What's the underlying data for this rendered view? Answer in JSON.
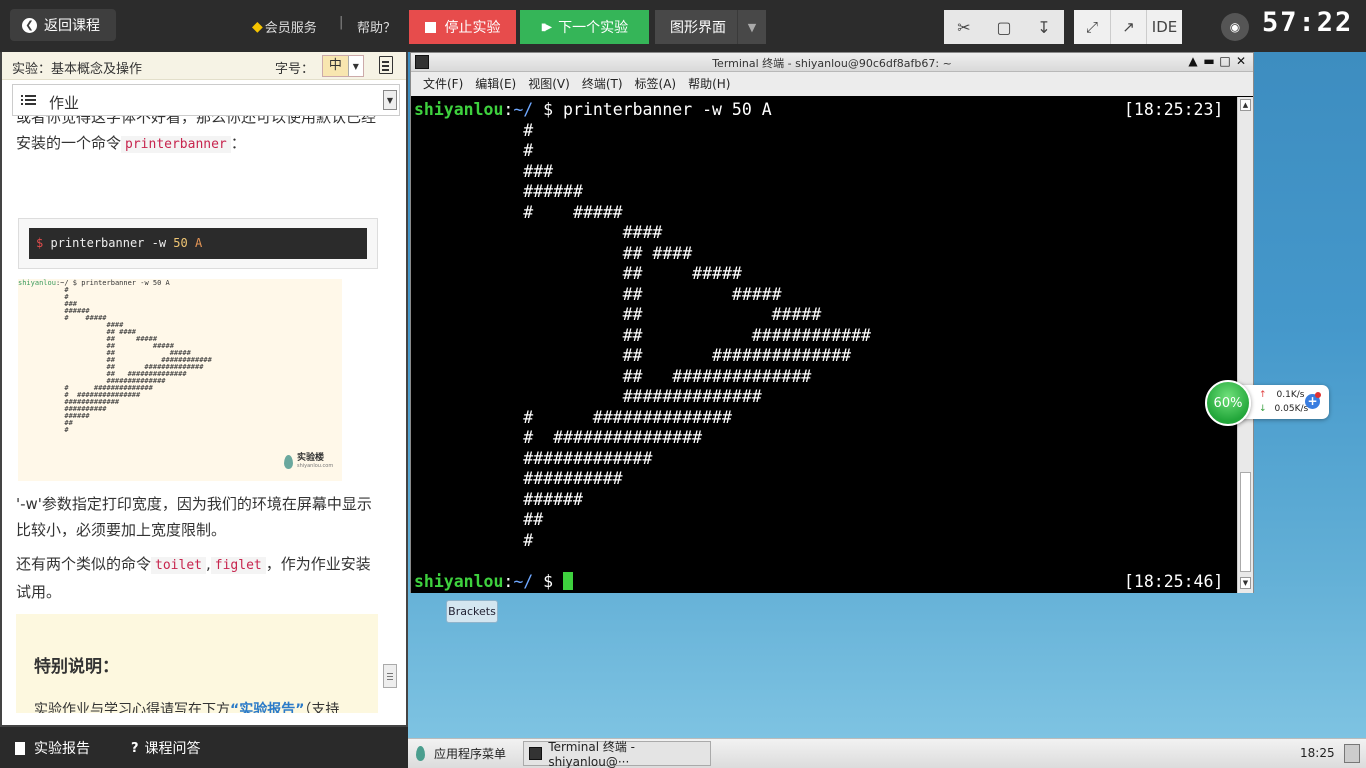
{
  "topbar": {
    "back_label": "返回课程",
    "vip_label": "会员服务",
    "separator": "|",
    "help_label": "帮助？",
    "stop_label": "停止实验",
    "next_label": "下一个实验",
    "gui_label": "图形界面",
    "ide_label": "IDE",
    "timer": "57:22"
  },
  "left_panel": {
    "title": "实验：基本概念及操作",
    "font_size_label": "字号：",
    "font_size_value": "中",
    "section_select": "作业",
    "para1_a": "或者你觉得这字体不好看，那么你还可以使用默认已经安装的一个命令",
    "para1_code": "printerbanner",
    "para1_b": "：",
    "code_prompt": "$",
    "code_cmd": "printerbanner -w",
    "code_num": "50",
    "code_arg": "A",
    "thumb_user": "shiyanlou",
    "thumb_cmd": ":~/ $ printerbanner -w 50 A",
    "thumb_logo": "实验楼",
    "thumb_logo_sub": "shiyanlou.com",
    "para2": "'-w'参数指定打印宽度，因为我们的环境在屏幕中显示比较小，必须要加上宽度限制。",
    "para3_a": "还有两个类似的命令",
    "para3_code1": "toilet",
    "para3_sep": ",",
    "para3_code2": "figlet",
    "para3_b": "，作为作业安装试用。",
    "note_title": "特别说明：",
    "note_a": "实验作业与学习心得请写在下方",
    "note_link": "“实验报告”",
    "note_b": "（支持markdown格式）里并公开，每周选取优秀报告奖励IT书籍！"
  },
  "footer": {
    "report_label": "实验报告",
    "qa_label": "课程问答"
  },
  "terminal": {
    "title": "Terminal 终端 - shiyanlou@90c6df8afb67: ~",
    "menu": [
      "文件(F)",
      "编辑(E)",
      "视图(V)",
      "终端(T)",
      "标签(A)",
      "帮助(H)"
    ],
    "user": "shiyanlou",
    "colon": ":",
    "path": "~/",
    "prompt_tail": " $ ",
    "command": "printerbanner -w 50 A",
    "time1": "[18:25:23]",
    "time2": "[18:25:46]",
    "output": "           #\n           #\n           ###\n           ######\n           #    #####\n                     ####\n                     ## ####\n                     ##     #####\n                     ##         #####\n                     ##             #####\n                     ##           ############\n                     ##       ##############\n                     ##   ##############\n                     ##############\n           #      ##############\n           #  ###############\n           #############\n           ##########\n           ######\n           ##\n           #"
  },
  "desktop": {
    "brackets_label": "Brackets",
    "net_percent": "60%",
    "net_up": "0.1K/s",
    "net_down": "0.05K/s"
  },
  "taskbar": {
    "apps_menu": "应用程序菜单",
    "task_label": "Terminal 终端 - shiyanlou@···",
    "clock": "18:25"
  }
}
